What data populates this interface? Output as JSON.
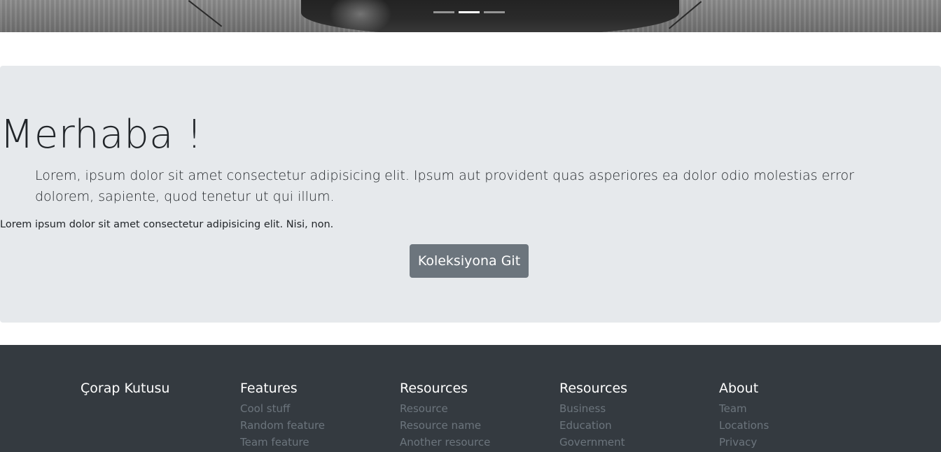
{
  "carousel": {
    "indicators": [
      {
        "active": false
      },
      {
        "active": true
      },
      {
        "active": false
      }
    ]
  },
  "jumbotron": {
    "title": "Merhaba !",
    "lead": "Lorem, ipsum dolor sit amet consectetur adipisicing elit. Ipsum aut provident quas asperiores ea dolor odio molestias error dolorem, sapiente, quod tenetur ut qui illum.",
    "text": "Lorem ipsum dolor sit amet consectetur adipisicing elit. Nisi, non.",
    "button_label": "Koleksiyona Git"
  },
  "footer": {
    "brand": "Çorap Kutusu",
    "columns": [
      {
        "heading": "Features",
        "links": [
          "Cool stuff",
          "Random feature",
          "Team feature"
        ]
      },
      {
        "heading": "Resources",
        "links": [
          "Resource",
          "Resource name",
          "Another resource"
        ]
      },
      {
        "heading": "Resources",
        "links": [
          "Business",
          "Education",
          "Government"
        ]
      },
      {
        "heading": "About",
        "links": [
          "Team",
          "Locations",
          "Privacy"
        ]
      }
    ]
  },
  "colors": {
    "jumbotron_bg": "#e6e9ec",
    "button_bg": "#6c757d",
    "footer_bg": "#343a40",
    "footer_link": "#6c757d"
  }
}
